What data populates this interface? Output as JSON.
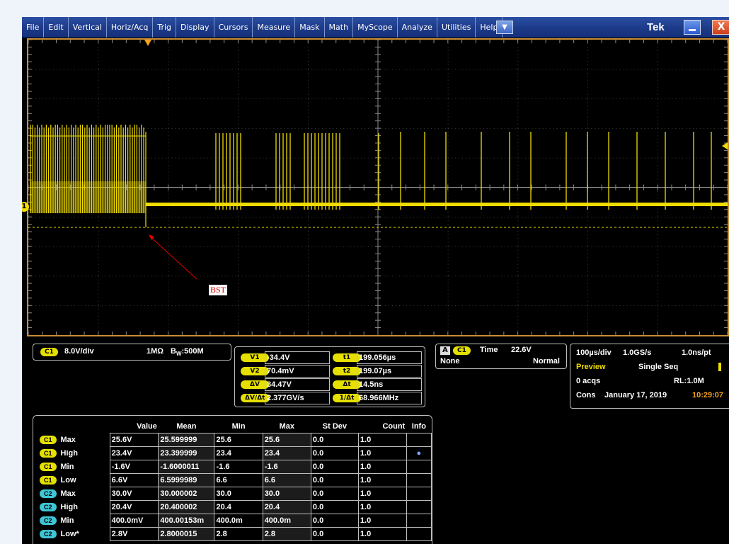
{
  "menu": {
    "items": [
      "File",
      "Edit",
      "Vertical",
      "Horiz/Acq",
      "Trig",
      "Display",
      "Cursors",
      "Measure",
      "Mask",
      "Math",
      "MyScope",
      "Analyze",
      "Utilities",
      "Help"
    ],
    "dropdown_icon": "chevron-down-icon"
  },
  "brand": "Tek",
  "window": {
    "minimize_icon": "minimize-icon",
    "close_label": "X"
  },
  "display": {
    "channel_marker": "1",
    "annotation": "BST",
    "trace_color": "#f0dc00",
    "grid_color": "#8c8c8c",
    "frame_color": "#c98d35"
  },
  "channel": {
    "badge": "C1",
    "scale": "8.0V/div",
    "coupling": "1MΩ",
    "bw_prefix": "B",
    "bw_sub": "W",
    "bw_value": ":500M"
  },
  "cursors": {
    "rows": [
      {
        "l_label": "V1",
        "l_value": "-34.4V",
        "r_label": "t1",
        "r_value": "199.056µs"
      },
      {
        "l_label": "V2",
        "l_value": "70.4mV",
        "r_label": "t2",
        "r_value": "199.07µs"
      },
      {
        "l_label": "ΔV",
        "l_value": "34.47V",
        "r_label": "Δt",
        "r_value": "14.5ns"
      },
      {
        "l_label": "ΔV/Δt",
        "l_value": "2.377GV/s",
        "r_label": "1/Δt",
        "r_value": "68.966MHz"
      }
    ]
  },
  "trigger": {
    "mode_badge": "A",
    "source_badge": "C1",
    "type": "Time",
    "level": "22.6V",
    "coupling": "None",
    "mode": "Normal"
  },
  "acquisition": {
    "timebase": "100µs/div",
    "sample_rate": "1.0GS/s",
    "resolution": "1.0ns/pt",
    "state": "Preview",
    "run_mode": "Single Seq",
    "acqs": "0 acqs",
    "record_length": "RL:1.0M",
    "cons": "Cons",
    "date": "January 17, 2019",
    "time": "10:29:07"
  },
  "measurements": {
    "headers": [
      "Value",
      "Mean",
      "Min",
      "Max",
      "St Dev",
      "Count",
      "Info"
    ],
    "rows": [
      {
        "ch": "C1",
        "name": "Max",
        "value": "25.6V",
        "mean": "25.599999",
        "min": "25.6",
        "max": "25.6",
        "stdev": "0.0",
        "count": "1.0",
        "info": ""
      },
      {
        "ch": "C1",
        "name": "High",
        "value": "23.4V",
        "mean": "23.399999",
        "min": "23.4",
        "max": "23.4",
        "stdev": "0.0",
        "count": "1.0",
        "info": "●"
      },
      {
        "ch": "C1",
        "name": "Min",
        "value": "-1.6V",
        "mean": "-1.6000011",
        "min": "-1.6",
        "max": "-1.6",
        "stdev": "0.0",
        "count": "1.0",
        "info": ""
      },
      {
        "ch": "C1",
        "name": "Low",
        "value": "6.6V",
        "mean": "6.5999989",
        "min": "6.6",
        "max": "6.6",
        "stdev": "0.0",
        "count": "1.0",
        "info": ""
      },
      {
        "ch": "C2",
        "name": "Max",
        "value": "30.0V",
        "mean": "30.000002",
        "min": "30.0",
        "max": "30.0",
        "stdev": "0.0",
        "count": "1.0",
        "info": ""
      },
      {
        "ch": "C2",
        "name": "High",
        "value": "20.4V",
        "mean": "20.400002",
        "min": "20.4",
        "max": "20.4",
        "stdev": "0.0",
        "count": "1.0",
        "info": ""
      },
      {
        "ch": "C2",
        "name": "Min",
        "value": "400.0mV",
        "mean": "400.00153m",
        "min": "400.0m",
        "max": "400.0m",
        "stdev": "0.0",
        "count": "1.0",
        "info": ""
      },
      {
        "ch": "C2",
        "name": "Low*",
        "value": "2.8V",
        "mean": "2.8000015",
        "min": "2.8",
        "max": "2.8",
        "stdev": "0.0",
        "count": "1.0",
        "info": ""
      }
    ]
  }
}
